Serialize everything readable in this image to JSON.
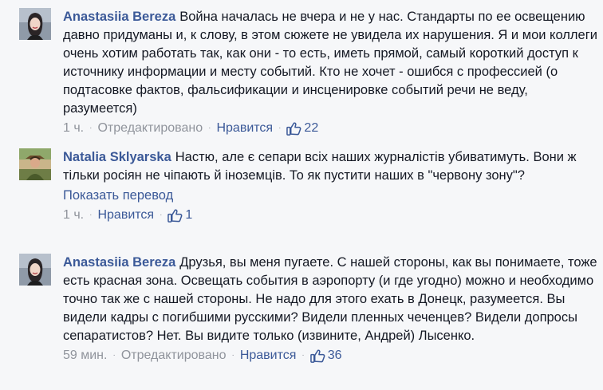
{
  "comments": [
    {
      "author": "Anastasiia Bereza",
      "avatar_icon": "woman-portrait-avatar",
      "text": "Война началась не вчера и не у нас. Стандарты по ее освещению давно придуманы и, к слову, в этом сюжете не увидела их нарушения. Я и мои коллеги очень хотим работать так, как они - то есть, иметь прямой, самый короткий доступ к источнику информации и месту событий. Кто не хочет - ошибся с профессией (о подтасовке фактов, фальсификации и инсценировке событий речи не веду, разумеется)",
      "time": "1 ч.",
      "edited": "Отредактировано",
      "like_label": "Нравится",
      "like_icon": "thumbs-up-icon",
      "likes": "22"
    },
    {
      "author": "Natalia Sklyarska",
      "avatar_icon": "woman-outdoor-avatar",
      "text": "Настю, але є сепари всіх наших журналістів убиватимуть. Вони ж тільки росіян не чіпають й іноземців. То як пустити наших в \"червону зону\"?",
      "translate": "Показать перевод",
      "time": "1 ч.",
      "like_label": "Нравится",
      "like_icon": "thumbs-up-icon",
      "likes": "1"
    },
    {
      "author": "Anastasiia Bereza",
      "avatar_icon": "woman-portrait-avatar",
      "text": "Друзья, вы меня пугаете. С нашей стороны, как вы понимаете, тоже есть красная зона. Освещать события в аэропорту (и где угодно) можно и необходимо точно так же с нашей стороны. Не надо для этого ехать в Донецк, разумеется. Вы видели кадры с погибшими русскими? Видели пленных чеченцев? Видели допросы сепаратистов? Нет. Вы видите только (извините, Андрей) Лысенко.",
      "time": "59 мин.",
      "edited": "Отредактировано",
      "like_label": "Нравится",
      "like_icon": "thumbs-up-icon",
      "likes": "36"
    }
  ],
  "separator": "·",
  "colors": {
    "link": "#3b5998",
    "meta": "#90949c",
    "background": "#f6f7f9",
    "text": "#141823"
  }
}
